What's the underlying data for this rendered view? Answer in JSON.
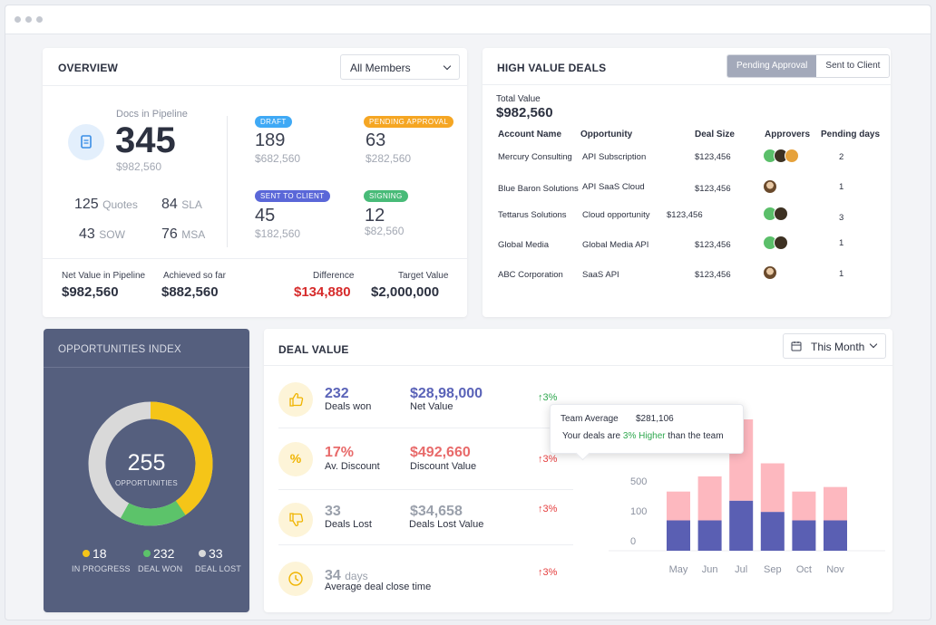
{
  "overview": {
    "title": "OVERVIEW",
    "member_select": "All Members",
    "docs_label": "Docs in Pipeline",
    "docs_count": "345",
    "docs_value": "$982,560",
    "quotes_num": "125",
    "quotes_lbl": "Quotes",
    "sla_num": "84",
    "sla_lbl": "SLA",
    "sow_num": "43",
    "sow_lbl": "SOW",
    "msa_num": "76",
    "msa_lbl": "MSA",
    "statuses": [
      {
        "label": "DRAFT",
        "count": "189",
        "value": "$682,560",
        "color": "#3fa9f5"
      },
      {
        "label": "PENDING APPROVAL",
        "count": "63",
        "value": "$282,560",
        "color": "#f5a623"
      },
      {
        "label": "SENT TO CLIENT",
        "count": "45",
        "value": "$182,560",
        "color": "#5a67d8"
      },
      {
        "label": "SIGNING",
        "count": "12",
        "value": "$82,560",
        "color": "#48bb78"
      }
    ],
    "footer": {
      "net_label": "Net Value in Pipeline",
      "net_value": "$982,560",
      "achieved_label": "Achieved so far",
      "achieved_value": "$882,560",
      "diff_label": "Difference",
      "diff_value": "$134,880",
      "target_label": "Target Value",
      "target_value": "$2,000,000"
    }
  },
  "high_value": {
    "title": "HIGH VALUE DEALS",
    "tab_pending": "Pending Approval",
    "tab_sent": "Sent to Client",
    "total_label": "Total Value",
    "total_value": "$982,560",
    "headers": {
      "account": "Account Name",
      "opportunity": "Opportunity",
      "size": "Deal Size",
      "approvers": "Approvers",
      "pending": "Pending days"
    },
    "rows": [
      {
        "account": "Mercury Consulting",
        "opportunity": "API Subscription",
        "size": "$123,456",
        "days": "2"
      },
      {
        "account": "Blue Baron Solutions",
        "opportunity": "API SaaS Cloud",
        "size": "$123,456",
        "days": "1"
      },
      {
        "account": "Tettarus Solutions",
        "opportunity": "Cloud opportunity",
        "size": "$123,456",
        "days": "3"
      },
      {
        "account": "Global Media",
        "opportunity": "Global Media API",
        "size": "$123,456",
        "days": "1"
      },
      {
        "account": "ABC Corporation",
        "opportunity": "SaaS API",
        "size": "$123,456",
        "days": "1"
      }
    ]
  },
  "opportunities": {
    "title": "OPPORTUNITIES INDEX",
    "total": "255",
    "total_label": "OPPORTUNITIES",
    "legend": [
      {
        "num": "18",
        "label": "IN PROGRESS",
        "color": "#f5c518"
      },
      {
        "num": "232",
        "label": "DEAL WON",
        "color": "#5cc36a"
      },
      {
        "num": "33",
        "label": "DEAL LOST",
        "color": "#d9d9d9"
      }
    ]
  },
  "deal_value": {
    "title": "DEAL VALUE",
    "period": "This Month",
    "metrics": [
      {
        "num": "232",
        "label": "Deals won",
        "amount": "$28,98,000",
        "amount_label": "Net Value",
        "trend": "3%",
        "up_color": "#2fa84f",
        "num_color": "#5a63b8"
      },
      {
        "num": "17%",
        "label": "Av. Discount",
        "amount": "$492,660",
        "amount_label": "Discount Value",
        "trend": "3%",
        "up_color": "#e53e3e",
        "num_color": "#e86a6a"
      },
      {
        "num": "33",
        "label": "Deals Lost",
        "amount": "$34,658",
        "amount_label": "Deals Lost Value",
        "trend": "3%",
        "up_color": "#e53e3e",
        "num_color": "#9aa0ab"
      },
      {
        "num": "34",
        "unit": "days",
        "label": "Average deal close time",
        "trend": "3%",
        "up_color": "#e53e3e",
        "num_color": "#9aa0ab"
      }
    ],
    "tooltip": {
      "label": "Team Average",
      "value": "$281,106",
      "line2_prefix": "Your deals are",
      "line2_highlight": "3% Higher",
      "line2_suffix": "than the team"
    }
  },
  "chart_data": {
    "type": "bar",
    "categories": [
      "May",
      "Jun",
      "Jul",
      "Sep",
      "Oct",
      "Nov"
    ],
    "series": [
      {
        "values": [
          100,
          100,
          165,
          128,
          100,
          100
        ],
        "color": "#5a5fb3"
      },
      {
        "values": [
          95,
          145,
          335,
          160,
          95,
          110
        ],
        "color": "#fdb8bf"
      }
    ],
    "yticks": [
      "0",
      "100",
      "500"
    ],
    "stacked": true
  }
}
